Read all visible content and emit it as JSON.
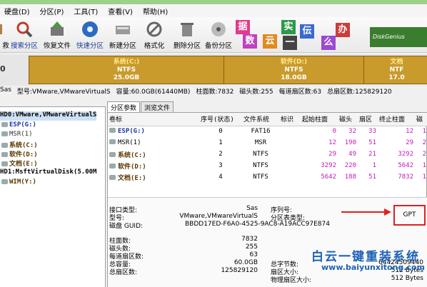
{
  "menu": [
    "硬盘(D)",
    "分区(P)",
    "工具(T)",
    "查看(V)",
    "帮助(H)"
  ],
  "toolbar": [
    {
      "label": "救",
      "icon": "partial-icon"
    },
    {
      "label": "搜索分区",
      "icon": "search-partition-icon",
      "blue": true
    },
    {
      "label": "恢复文件",
      "icon": "recover-files-icon"
    },
    {
      "label": "快速分区",
      "icon": "quick-partition-icon",
      "blue": true
    },
    {
      "label": "新建分区",
      "icon": "new-partition-icon"
    },
    {
      "label": "格式化",
      "icon": "format-icon"
    },
    {
      "label": "删除分区",
      "icon": "delete-partition-icon"
    },
    {
      "label": "备份分区",
      "icon": "backup-partition-icon"
    }
  ],
  "watermark": {
    "chars": [
      "据",
      "实",
      "伝",
      "办",
      "数",
      "云",
      "一",
      "么"
    ],
    "logo_text": "DiskGenius"
  },
  "disk_map": {
    "left_label": "0",
    "partitions": [
      {
        "name": "系统(C:)",
        "fs": "NTFS",
        "size": "25.0GB"
      },
      {
        "name": "软件(D:)",
        "fs": "NTFS",
        "size": "18.0GB"
      },
      {
        "name": "文档",
        "fs": "NTF",
        "size": "17.0"
      }
    ]
  },
  "disk_info": {
    "iface": "Sas",
    "model": "型号:VMware,VMwareVirtualS",
    "capacity": "容量:60.0GB(61440MB)",
    "cylinders": "柱面数:7832",
    "heads": "磁头数:255",
    "sectors_per_track": "每道扇区数:63",
    "total_sectors": "总扇区数:125829120"
  },
  "tree": [
    {
      "label": "HD0:VMware,VMwareVirtualS",
      "kind": "disk",
      "selected": true
    },
    {
      "label": "ESP(G:)",
      "kind": "esp"
    },
    {
      "label": "MSR(1)",
      "kind": "msr"
    },
    {
      "label": "系统(C:)",
      "kind": "part"
    },
    {
      "label": "软件(D:)",
      "kind": "part"
    },
    {
      "label": "文档(E:)",
      "kind": "part"
    },
    {
      "label": "HD1:MsftVirtualDisk(5.00M",
      "kind": "disk"
    },
    {
      "label": "WIM(Y:)",
      "kind": "part"
    }
  ],
  "tabs": [
    "分区参数",
    "浏览文件"
  ],
  "table": {
    "headers": [
      "卷标",
      "序号(状态)",
      "文件系统",
      "标识",
      "起始柱面",
      "磁头",
      "扇区",
      "终止柱面",
      "磁"
    ],
    "rows": [
      {
        "vol": "ESP(G:)",
        "cls": "esp",
        "idx": "0",
        "fs": "FAT16",
        "id": "",
        "sc": "0",
        "h": "32",
        "s": "33",
        "ec": "12",
        "eh": "1"
      },
      {
        "vol": "MSR(1)",
        "cls": "msr",
        "idx": "1",
        "fs": "MSR",
        "id": "",
        "sc": "12",
        "h": "190",
        "s": "51",
        "ec": "29",
        "eh": "2"
      },
      {
        "vol": "系统(C:)",
        "cls": "brown",
        "idx": "2",
        "fs": "NTFS",
        "id": "",
        "sc": "29",
        "h": "49",
        "s": "21",
        "ec": "3292",
        "eh": "2"
      },
      {
        "vol": "软件(D:)",
        "cls": "brown",
        "idx": "3",
        "fs": "NTFS",
        "id": "",
        "sc": "3292",
        "h": "220",
        "s": "1",
        "ec": "5642",
        "eh": "1"
      },
      {
        "vol": "文档(E:)",
        "cls": "brown",
        "idx": "4",
        "fs": "NTFS",
        "id": "",
        "sc": "5642",
        "h": "188",
        "s": "51",
        "ec": "7832",
        "eh": "1"
      }
    ]
  },
  "detail": {
    "iface_label": "接口类型:",
    "iface_val": "Sas",
    "serial_label": "序列号:",
    "model_label": "型号:",
    "model_val": "VMware,VMwareVirtualS",
    "pt_label": "分区表类型:",
    "pt_val": "GPT",
    "guid_label": "磁盘 GUID:",
    "guid_val": "BBDD17ED-F6A0-4525-9AC8-A19ACC97E874",
    "cyl_label": "柱面数:",
    "cyl_val": "7832",
    "heads_label": "磁头数:",
    "heads_val": "255",
    "spt_label": "每道扇区数:",
    "spt_val": "63",
    "cap_label": "总容量:",
    "cap_val": "60.0GB",
    "total_label": "总扇区数:",
    "total_val": "125829120",
    "bytes_label": "总字节数:",
    "bytes_val": "64424509440",
    "sector_label": "扇区大小:",
    "sector_val": "512 Bytes",
    "phys_label": "物理扇区大小:",
    "phys_val": "512 Bytes"
  },
  "brand": {
    "title": "白云一键重装系统",
    "url": "www.baiyunxitong.com"
  }
}
